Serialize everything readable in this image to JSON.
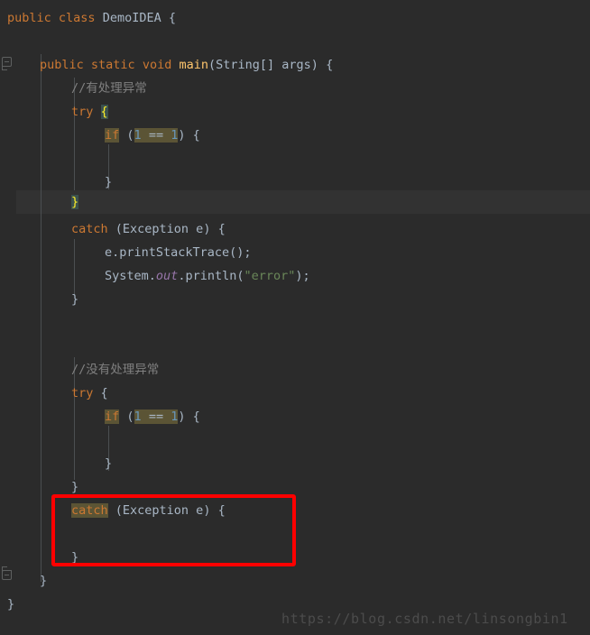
{
  "editor": {
    "background_color": "#2b2b2b",
    "current_line_color": "#323232",
    "default_text_color": "#a9b7c6",
    "keyword_color": "#cc7832",
    "number_color": "#6897bb",
    "string_color": "#6a8759",
    "comment_color": "#808080",
    "method_color": "#ffc66d",
    "field_color": "#9876aa",
    "highlight_color": "#5b5435",
    "brace_match_color": "#3b514d",
    "brace_match_text_color": "#ffef28",
    "indent_guide_color": "#4b4f51",
    "fold_marker_color": "#5e6060"
  },
  "code": {
    "line1": {
      "kw_public": "public",
      "kw_class": "class",
      "name": "DemoIDEA",
      "brace": "{"
    },
    "line3": {
      "kw_public": "public",
      "kw_static": "static",
      "kw_void": "void",
      "method": "main",
      "params": "(String[] args)",
      "brace": "{"
    },
    "line4_comment": "//有处理异常",
    "line5": {
      "kw_try": "try",
      "brace": "{"
    },
    "line6": {
      "kw_if": "if",
      "open_paren": "(",
      "left": "1",
      "op": "==",
      "right": "1",
      "close_paren": ")",
      "brace": "{"
    },
    "line8_close": "}",
    "line9_close": "}",
    "line10": {
      "kw_catch": "catch",
      "params": "(Exception e)",
      "brace": "{"
    },
    "line11": "e.printStackTrace();",
    "line12": {
      "obj": "System",
      "dot1": ".",
      "field": "out",
      "dot2": ".",
      "method": "println",
      "open_paren": "(",
      "string": "\"error\"",
      "close_paren": ")",
      "semi": ";"
    },
    "line13_close": "}",
    "line16_comment": "//没有处理异常",
    "line17": {
      "kw_try": "try",
      "brace": "{"
    },
    "line18": {
      "kw_if": "if",
      "open_paren": "(",
      "left": "1",
      "op": "==",
      "right": "1",
      "close_paren": ")",
      "brace": "{"
    },
    "line20_close": "}",
    "line21_close": "}",
    "line22": {
      "kw_catch": "catch",
      "params": "(Exception e)",
      "brace": "{"
    },
    "line24_close": "}",
    "line25_close": "}",
    "line26_close": "}"
  },
  "annotation": {
    "color": "#fe0000",
    "target": "empty-catch-block"
  },
  "watermark": {
    "text": "https://blog.csdn.net/linsongbin1"
  }
}
